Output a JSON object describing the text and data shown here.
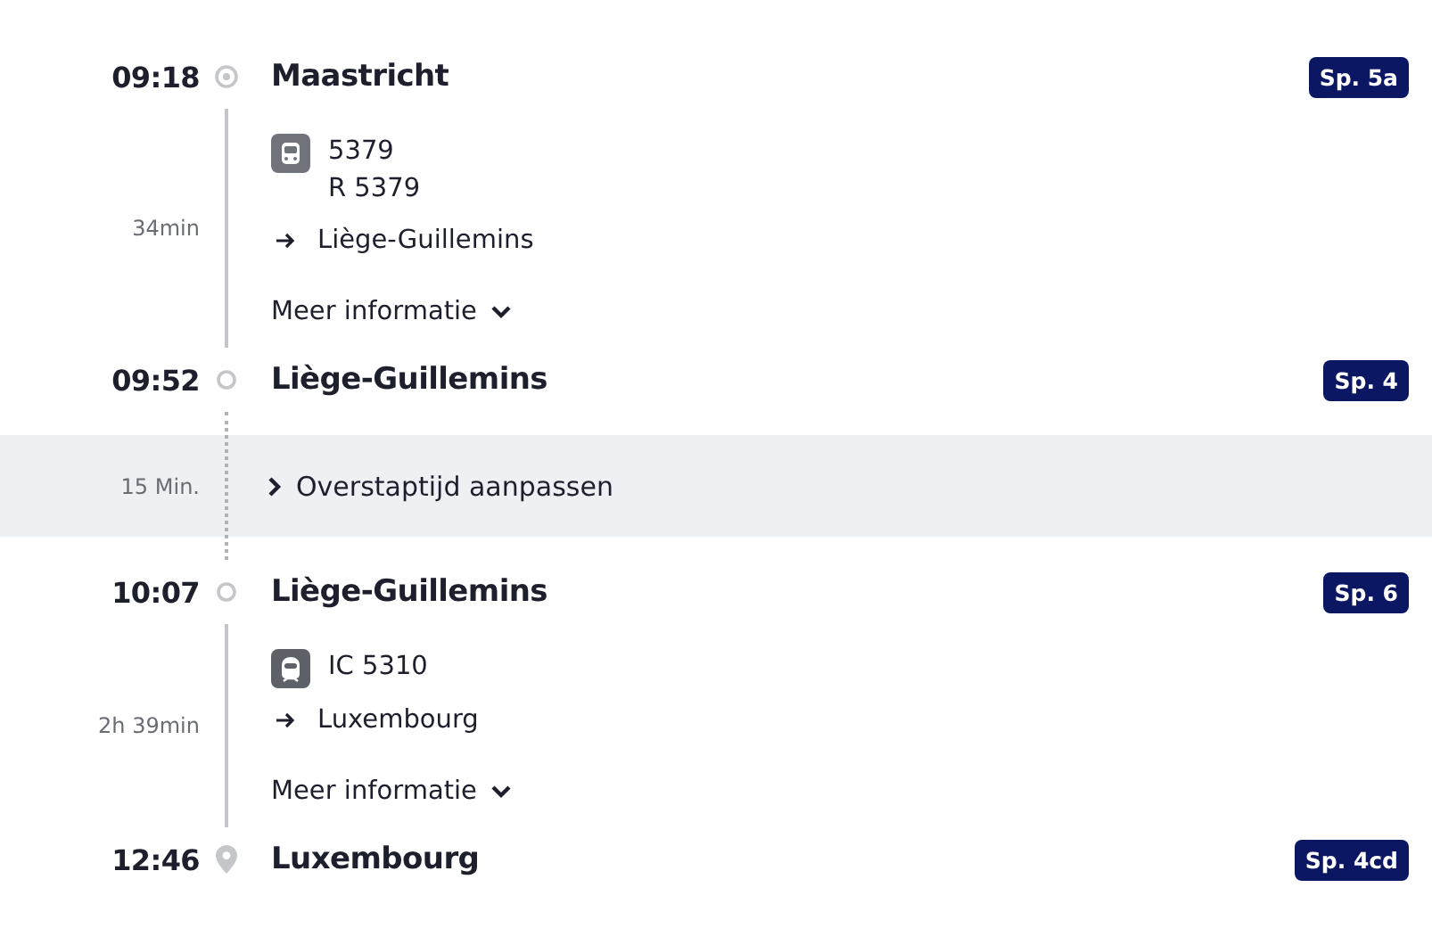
{
  "journey": [
    {
      "kind": "stop",
      "time": "09:18",
      "station": "Maastricht",
      "platform": "Sp. 5a",
      "marker": {
        "kind": "origin"
      }
    },
    {
      "kind": "leg",
      "duration": "34min",
      "train_icon": {
        "kind": "regional"
      },
      "train_lines": [
        "5379",
        "R 5379"
      ],
      "direction": "Liège-Guillemins",
      "more_info": "Meer informatie"
    },
    {
      "kind": "stop",
      "time": "09:52",
      "station": "Liège-Guillemins",
      "platform": "Sp. 4",
      "marker": {
        "kind": "stop"
      }
    },
    {
      "kind": "transfer",
      "duration": "15 Min.",
      "action": "Overstaptijd aanpassen"
    },
    {
      "kind": "stop",
      "time": "10:07",
      "station": "Liège-Guillemins",
      "platform": "Sp. 6",
      "marker": {
        "kind": "stop"
      }
    },
    {
      "kind": "leg",
      "duration": "2h 39min",
      "train_icon": {
        "kind": "intercity"
      },
      "train_lines": [
        "IC 5310"
      ],
      "direction": "Luxembourg",
      "more_info": "Meer informatie"
    },
    {
      "kind": "stop",
      "time": "12:46",
      "station": "Luxembourg",
      "platform": "Sp. 4cd",
      "marker": {
        "kind": "destination"
      }
    }
  ]
}
